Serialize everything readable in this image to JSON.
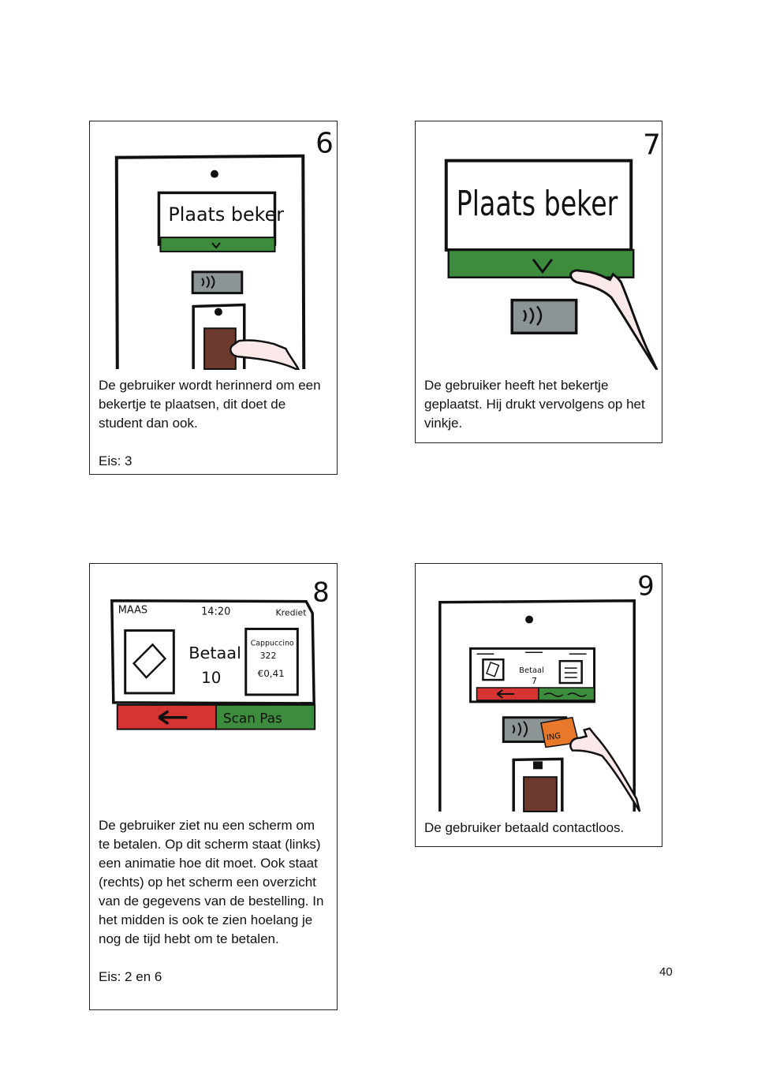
{
  "page_number": "40",
  "panels": [
    {
      "number": "6",
      "screen_text": "Plaats beker",
      "caption": "De gebruiker wordt herinnerd om een bekertje te plaatsen, dit doet de student dan ook.",
      "eis": "Eis: 3"
    },
    {
      "number": "7",
      "screen_text": "Plaats beker",
      "caption": "De gebruiker heeft het bekertje geplaatst. Hij drukt vervolgens op het vinkje."
    },
    {
      "number": "8",
      "header_left": "MAAS",
      "header_time": "14:20",
      "header_right": "Krediet",
      "center_line1": "Betaal",
      "center_line2": "10",
      "order_line1": "Cappuccino",
      "order_line2": "322",
      "order_line3": "€0,41",
      "scan_label": "Scan Pas",
      "caption": "De gebruiker ziet nu een scherm om te betalen. Op dit scherm staat (links) een animatie hoe dit moet. Ook staat (rechts) op het scherm een overzicht van de gegevens van de bestelling. In het midden is ook te zien hoelang je nog de tijd hebt om te betalen.",
      "eis": "Eis: 2 en 6"
    },
    {
      "number": "9",
      "center_line1": "Betaal",
      "center_line2": "7",
      "card_label": "ING",
      "caption": "De gebruiker betaald contactloos."
    }
  ],
  "colors": {
    "green": "#3d8b3d",
    "red": "#d63333",
    "grey": "#8c9496",
    "cup": "#6e3a2e",
    "skin": "#fbe8e8",
    "card": "#e8782a"
  }
}
